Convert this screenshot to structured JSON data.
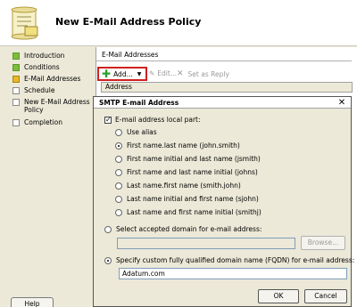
{
  "wizard": {
    "title": "New E-Mail Address Policy"
  },
  "steps": [
    {
      "label": "Introduction",
      "state": "done"
    },
    {
      "label": "Conditions",
      "state": "done"
    },
    {
      "label": "E-Mail Addresses",
      "state": "current"
    },
    {
      "label": "Schedule",
      "state": "pending"
    },
    {
      "label": "New E-Mail Address Policy",
      "state": "pending"
    },
    {
      "label": "Completion",
      "state": "pending"
    }
  ],
  "help_label": "Help",
  "panel": {
    "section_title": "E-Mail Addresses",
    "toolbar": {
      "add_label": "Add...",
      "edit_label": "Edit...",
      "set_reply_label": "Set as Reply"
    },
    "list_header": "Address"
  },
  "dialog": {
    "title": "SMTP E-mail Address",
    "local_part_label": "E-mail address local part:",
    "options": [
      {
        "label": "Use alias",
        "selected": false
      },
      {
        "label": "First name.last name (john.smith)",
        "selected": true
      },
      {
        "label": "First name initial and last name (jsmith)",
        "selected": false
      },
      {
        "label": "First name and last name initial (johns)",
        "selected": false
      },
      {
        "label": "Last name.first name (smith.john)",
        "selected": false
      },
      {
        "label": "Last name initial and first name (sjohn)",
        "selected": false
      },
      {
        "label": "Last name and first name initial (smithj)",
        "selected": false
      }
    ],
    "accepted_domain_label": "Select accepted domain for e-mail address:",
    "browse_label": "Browse...",
    "fqdn_label": "Specify custom fully qualified domain name (FQDN) for e-mail address:",
    "fqdn_value": "Adatum.com",
    "ok_label": "OK",
    "cancel_label": "Cancel"
  }
}
